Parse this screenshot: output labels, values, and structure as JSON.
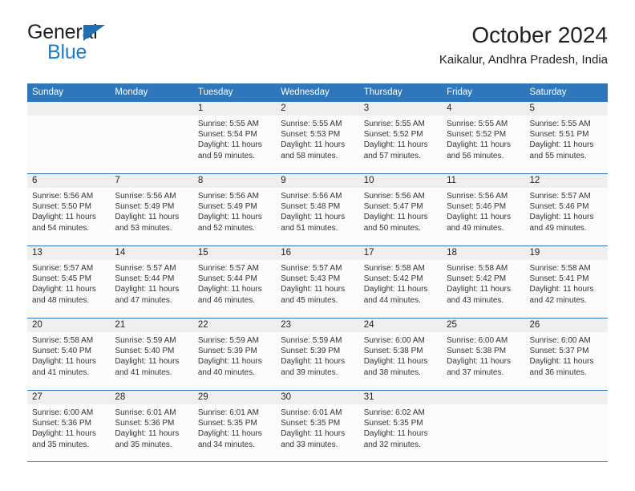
{
  "brand": {
    "word_one": "General",
    "word_two": "Blue",
    "triangle_color": "#1f6fb5",
    "blue_color": "#1b7ad1"
  },
  "header": {
    "title": "October 2024",
    "subtitle": "Kaikalur, Andhra Pradesh, India"
  },
  "theme": {
    "header_blue": "#2e77ba",
    "date_band_gray": "#efefef",
    "text_color": "#231f20"
  },
  "weekdays": [
    "Sunday",
    "Monday",
    "Tuesday",
    "Wednesday",
    "Thursday",
    "Friday",
    "Saturday"
  ],
  "weeks": [
    [
      {
        "day": "",
        "sunrise": "",
        "sunset": "",
        "daylight_line1": "",
        "daylight_line2": ""
      },
      {
        "day": "",
        "sunrise": "",
        "sunset": "",
        "daylight_line1": "",
        "daylight_line2": ""
      },
      {
        "day": "1",
        "sunrise": "Sunrise: 5:55 AM",
        "sunset": "Sunset: 5:54 PM",
        "daylight_line1": "Daylight: 11 hours",
        "daylight_line2": "and 59 minutes."
      },
      {
        "day": "2",
        "sunrise": "Sunrise: 5:55 AM",
        "sunset": "Sunset: 5:53 PM",
        "daylight_line1": "Daylight: 11 hours",
        "daylight_line2": "and 58 minutes."
      },
      {
        "day": "3",
        "sunrise": "Sunrise: 5:55 AM",
        "sunset": "Sunset: 5:52 PM",
        "daylight_line1": "Daylight: 11 hours",
        "daylight_line2": "and 57 minutes."
      },
      {
        "day": "4",
        "sunrise": "Sunrise: 5:55 AM",
        "sunset": "Sunset: 5:52 PM",
        "daylight_line1": "Daylight: 11 hours",
        "daylight_line2": "and 56 minutes."
      },
      {
        "day": "5",
        "sunrise": "Sunrise: 5:55 AM",
        "sunset": "Sunset: 5:51 PM",
        "daylight_line1": "Daylight: 11 hours",
        "daylight_line2": "and 55 minutes."
      }
    ],
    [
      {
        "day": "6",
        "sunrise": "Sunrise: 5:56 AM",
        "sunset": "Sunset: 5:50 PM",
        "daylight_line1": "Daylight: 11 hours",
        "daylight_line2": "and 54 minutes."
      },
      {
        "day": "7",
        "sunrise": "Sunrise: 5:56 AM",
        "sunset": "Sunset: 5:49 PM",
        "daylight_line1": "Daylight: 11 hours",
        "daylight_line2": "and 53 minutes."
      },
      {
        "day": "8",
        "sunrise": "Sunrise: 5:56 AM",
        "sunset": "Sunset: 5:49 PM",
        "daylight_line1": "Daylight: 11 hours",
        "daylight_line2": "and 52 minutes."
      },
      {
        "day": "9",
        "sunrise": "Sunrise: 5:56 AM",
        "sunset": "Sunset: 5:48 PM",
        "daylight_line1": "Daylight: 11 hours",
        "daylight_line2": "and 51 minutes."
      },
      {
        "day": "10",
        "sunrise": "Sunrise: 5:56 AM",
        "sunset": "Sunset: 5:47 PM",
        "daylight_line1": "Daylight: 11 hours",
        "daylight_line2": "and 50 minutes."
      },
      {
        "day": "11",
        "sunrise": "Sunrise: 5:56 AM",
        "sunset": "Sunset: 5:46 PM",
        "daylight_line1": "Daylight: 11 hours",
        "daylight_line2": "and 49 minutes."
      },
      {
        "day": "12",
        "sunrise": "Sunrise: 5:57 AM",
        "sunset": "Sunset: 5:46 PM",
        "daylight_line1": "Daylight: 11 hours",
        "daylight_line2": "and 49 minutes."
      }
    ],
    [
      {
        "day": "13",
        "sunrise": "Sunrise: 5:57 AM",
        "sunset": "Sunset: 5:45 PM",
        "daylight_line1": "Daylight: 11 hours",
        "daylight_line2": "and 48 minutes."
      },
      {
        "day": "14",
        "sunrise": "Sunrise: 5:57 AM",
        "sunset": "Sunset: 5:44 PM",
        "daylight_line1": "Daylight: 11 hours",
        "daylight_line2": "and 47 minutes."
      },
      {
        "day": "15",
        "sunrise": "Sunrise: 5:57 AM",
        "sunset": "Sunset: 5:44 PM",
        "daylight_line1": "Daylight: 11 hours",
        "daylight_line2": "and 46 minutes."
      },
      {
        "day": "16",
        "sunrise": "Sunrise: 5:57 AM",
        "sunset": "Sunset: 5:43 PM",
        "daylight_line1": "Daylight: 11 hours",
        "daylight_line2": "and 45 minutes."
      },
      {
        "day": "17",
        "sunrise": "Sunrise: 5:58 AM",
        "sunset": "Sunset: 5:42 PM",
        "daylight_line1": "Daylight: 11 hours",
        "daylight_line2": "and 44 minutes."
      },
      {
        "day": "18",
        "sunrise": "Sunrise: 5:58 AM",
        "sunset": "Sunset: 5:42 PM",
        "daylight_line1": "Daylight: 11 hours",
        "daylight_line2": "and 43 minutes."
      },
      {
        "day": "19",
        "sunrise": "Sunrise: 5:58 AM",
        "sunset": "Sunset: 5:41 PM",
        "daylight_line1": "Daylight: 11 hours",
        "daylight_line2": "and 42 minutes."
      }
    ],
    [
      {
        "day": "20",
        "sunrise": "Sunrise: 5:58 AM",
        "sunset": "Sunset: 5:40 PM",
        "daylight_line1": "Daylight: 11 hours",
        "daylight_line2": "and 41 minutes."
      },
      {
        "day": "21",
        "sunrise": "Sunrise: 5:59 AM",
        "sunset": "Sunset: 5:40 PM",
        "daylight_line1": "Daylight: 11 hours",
        "daylight_line2": "and 41 minutes."
      },
      {
        "day": "22",
        "sunrise": "Sunrise: 5:59 AM",
        "sunset": "Sunset: 5:39 PM",
        "daylight_line1": "Daylight: 11 hours",
        "daylight_line2": "and 40 minutes."
      },
      {
        "day": "23",
        "sunrise": "Sunrise: 5:59 AM",
        "sunset": "Sunset: 5:39 PM",
        "daylight_line1": "Daylight: 11 hours",
        "daylight_line2": "and 39 minutes."
      },
      {
        "day": "24",
        "sunrise": "Sunrise: 6:00 AM",
        "sunset": "Sunset: 5:38 PM",
        "daylight_line1": "Daylight: 11 hours",
        "daylight_line2": "and 38 minutes."
      },
      {
        "day": "25",
        "sunrise": "Sunrise: 6:00 AM",
        "sunset": "Sunset: 5:38 PM",
        "daylight_line1": "Daylight: 11 hours",
        "daylight_line2": "and 37 minutes."
      },
      {
        "day": "26",
        "sunrise": "Sunrise: 6:00 AM",
        "sunset": "Sunset: 5:37 PM",
        "daylight_line1": "Daylight: 11 hours",
        "daylight_line2": "and 36 minutes."
      }
    ],
    [
      {
        "day": "27",
        "sunrise": "Sunrise: 6:00 AM",
        "sunset": "Sunset: 5:36 PM",
        "daylight_line1": "Daylight: 11 hours",
        "daylight_line2": "and 35 minutes."
      },
      {
        "day": "28",
        "sunrise": "Sunrise: 6:01 AM",
        "sunset": "Sunset: 5:36 PM",
        "daylight_line1": "Daylight: 11 hours",
        "daylight_line2": "and 35 minutes."
      },
      {
        "day": "29",
        "sunrise": "Sunrise: 6:01 AM",
        "sunset": "Sunset: 5:35 PM",
        "daylight_line1": "Daylight: 11 hours",
        "daylight_line2": "and 34 minutes."
      },
      {
        "day": "30",
        "sunrise": "Sunrise: 6:01 AM",
        "sunset": "Sunset: 5:35 PM",
        "daylight_line1": "Daylight: 11 hours",
        "daylight_line2": "and 33 minutes."
      },
      {
        "day": "31",
        "sunrise": "Sunrise: 6:02 AM",
        "sunset": "Sunset: 5:35 PM",
        "daylight_line1": "Daylight: 11 hours",
        "daylight_line2": "and 32 minutes."
      },
      {
        "day": "",
        "sunrise": "",
        "sunset": "",
        "daylight_line1": "",
        "daylight_line2": ""
      },
      {
        "day": "",
        "sunrise": "",
        "sunset": "",
        "daylight_line1": "",
        "daylight_line2": ""
      }
    ]
  ]
}
